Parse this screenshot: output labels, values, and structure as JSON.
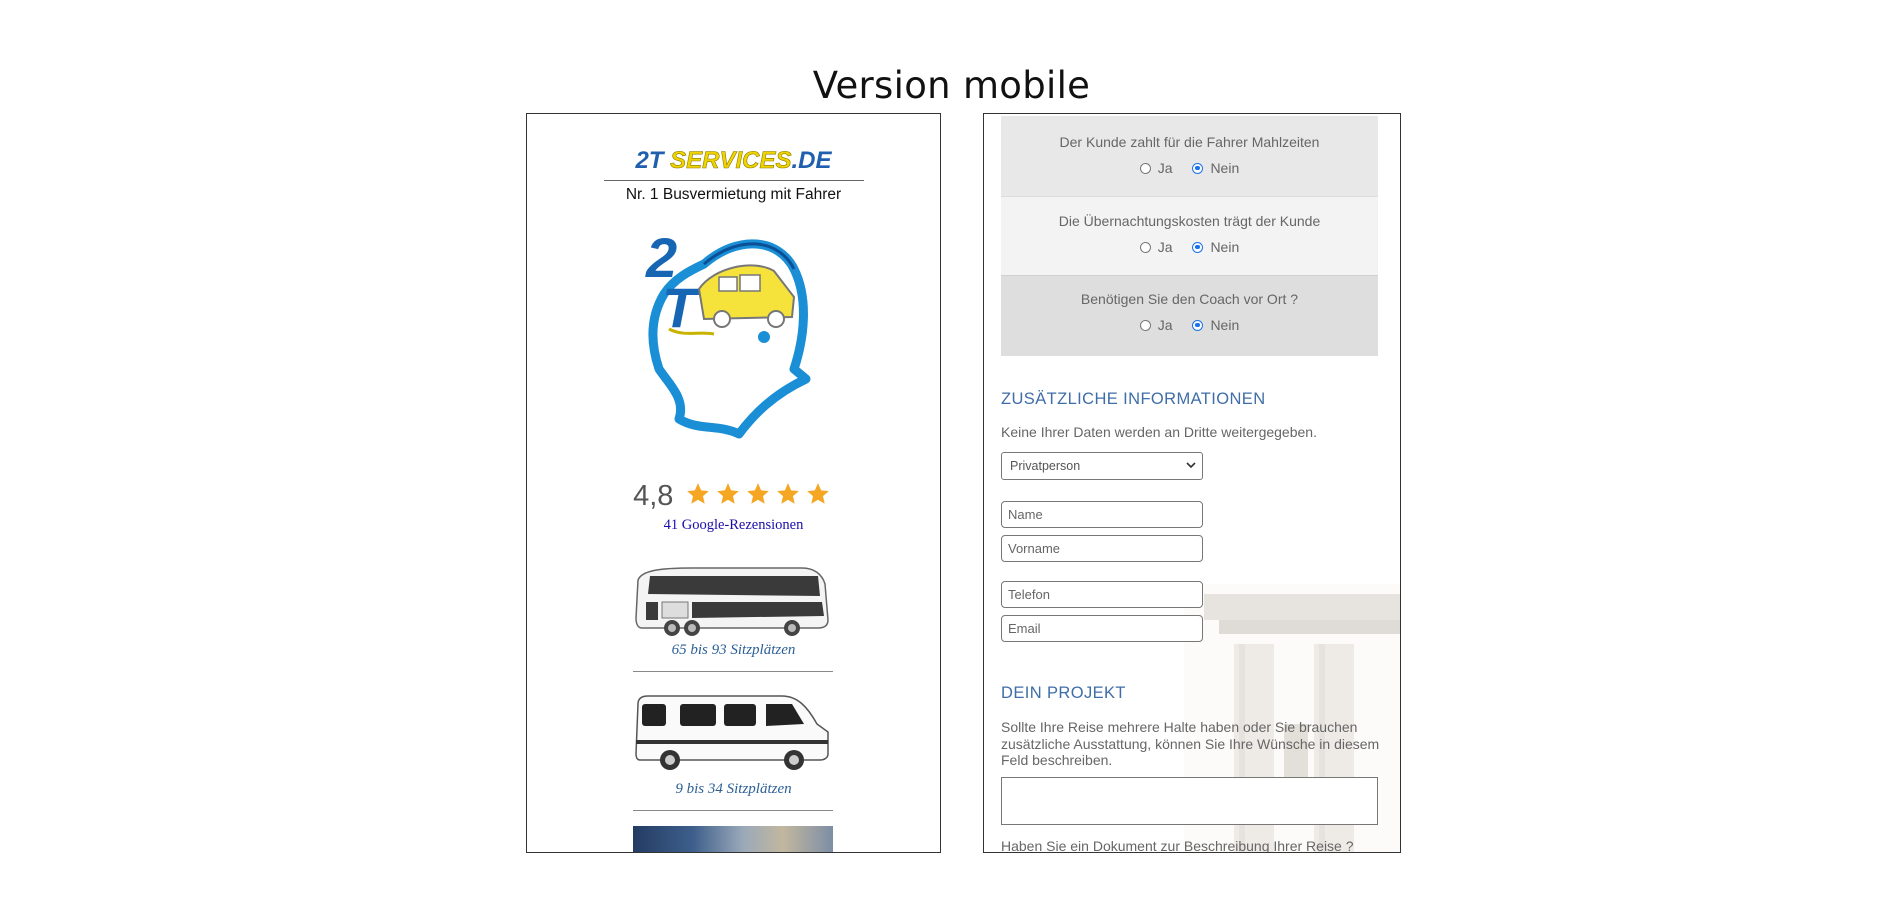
{
  "heading": "Version mobile",
  "left": {
    "brand_part1": "2T ",
    "brand_part2": "SERVICES",
    "brand_part3": ".DE",
    "tagline": "Nr. 1 Busvermietung mit Fahrer",
    "logo_icon": "2t-services-logo",
    "rating_score": "4,8",
    "rating_stars": 5,
    "reviews_link": "41 Google-Rezensionen",
    "vehicles": [
      {
        "icon": "double-decker-bus-icon",
        "caption": "65 bis 93 Sitzplätzen"
      },
      {
        "icon": "minibus-icon",
        "caption": "9 bis 34 Sitzplätzen"
      }
    ]
  },
  "right": {
    "questions": [
      {
        "text": "Der Kunde zahlt für die Fahrer Mahlzeiten",
        "yes": "Ja",
        "no": "Nein",
        "selected": "Nein"
      },
      {
        "text": "Die Übernachtungskosten trägt der Kunde",
        "yes": "Ja",
        "no": "Nein",
        "selected": "Nein"
      },
      {
        "text": "Benötigen Sie den Coach vor Ort ?",
        "yes": "Ja",
        "no": "Nein",
        "selected": "Nein"
      }
    ],
    "info_title": "ZUSÄTZLICHE INFORMATIONEN",
    "privacy_note": "Keine Ihrer Daten werden an Dritte weitergegeben.",
    "customer_type": "Privatperson",
    "fields": {
      "name": "Name",
      "vorname": "Vorname",
      "telefon": "Telefon",
      "email": "Email"
    },
    "project_title": "DEIN PROJEKT",
    "project_note": "Sollte Ihre Reise mehrere Halte haben oder Sie brauchen zusätzliche Ausstattung, können Sie Ihre Wünsche in diesem Feld beschreiben.",
    "document_question": "Haben Sie ein Dokument zur Beschreibung Ihrer Reise ?"
  },
  "colors": {
    "accent_blue": "#3f6da8",
    "brand_yellow": "#f0d400",
    "star_orange": "#f5a623",
    "radio_blue": "#1a73e8"
  }
}
